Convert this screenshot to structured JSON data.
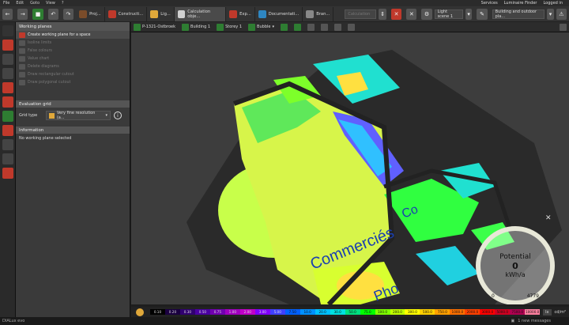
{
  "menu": [
    "File",
    "Edit",
    "Goto",
    "View",
    "?"
  ],
  "menu_right": {
    "services": "Services",
    "luminaire_finder": "Luminaire Finder",
    "login": "Logged in"
  },
  "toolbar": {
    "tabs": [
      {
        "label": "Proj...",
        "color": "#7a4c2a"
      },
      {
        "label": "Constructi...",
        "color": "#c0392b"
      },
      {
        "label": "Lig...",
        "color": "#e0a83a"
      },
      {
        "label": "Calculation obje...",
        "color": "#d0d0d0"
      },
      {
        "label": "Exp...",
        "color": "#c0392b"
      },
      {
        "label": "Documentati...",
        "color": "#2e86c1"
      },
      {
        "label": "Bran...",
        "color": "#888888"
      }
    ],
    "calc_placeholder": "Calculation",
    "light_scene": "Light scene 1",
    "view_filter": "Building and outdoor pla..."
  },
  "viewbar": {
    "project": "P-1321-Ostbroek",
    "building": "Building 1",
    "storey": "Storey 1",
    "mode": "Bubble"
  },
  "panel": {
    "working_planes": "Working planes",
    "items": [
      {
        "label": "Create working plane for a space",
        "enabled": true
      },
      {
        "label": "Isoline limits",
        "enabled": false
      },
      {
        "label": "False colours",
        "enabled": false
      },
      {
        "label": "Value chart",
        "enabled": false
      },
      {
        "label": "Delete diagrams",
        "enabled": false
      },
      {
        "label": "Draw rectangular cutout",
        "enabled": false
      },
      {
        "label": "Draw polygonal cutout",
        "enabled": false
      }
    ],
    "evaluation_grid": "Evaluation grid",
    "grid_type_label": "Grid type",
    "grid_type_value": "Very fine resolution (a...",
    "information": "Information",
    "info_text": "No working plane selected"
  },
  "scene": {
    "labels": [
      "Commerciés",
      "Co",
      "Pho"
    ]
  },
  "gauge": {
    "title": "Potential",
    "value": "0",
    "unit": "kWh/a",
    "min": "0",
    "max": "4779"
  },
  "legend": {
    "values": [
      "0.10",
      "0.20",
      "0.30",
      "0.50",
      "0.75",
      "1.00",
      "2.00",
      "3.00",
      "5.00",
      "7.50",
      "10.0",
      "20.0",
      "30.0",
      "50.0",
      "75.0",
      "100.0",
      "200.0",
      "300.0",
      "500.0",
      "750.0",
      "1000.0",
      "2000.0",
      "3000.0",
      "5000.0",
      "7500.0",
      "10000.0"
    ],
    "colors": [
      "#000000",
      "#1a0040",
      "#300070",
      "#4a00a0",
      "#7000b0",
      "#a000c0",
      "#c000c8",
      "#8000ff",
      "#4040ff",
      "#0060ff",
      "#0090ff",
      "#00c0ff",
      "#00e0e0",
      "#00e080",
      "#00ff00",
      "#80ff00",
      "#c0ff00",
      "#ffff00",
      "#ffd000",
      "#ffa000",
      "#ff7000",
      "#ff4000",
      "#ff0000",
      "#d00020",
      "#b00050",
      "#ff80a0"
    ],
    "unit": "lx",
    "unit2": "cd/m²"
  },
  "status": {
    "app": "DIALux evo",
    "messages": "1 new messages"
  }
}
